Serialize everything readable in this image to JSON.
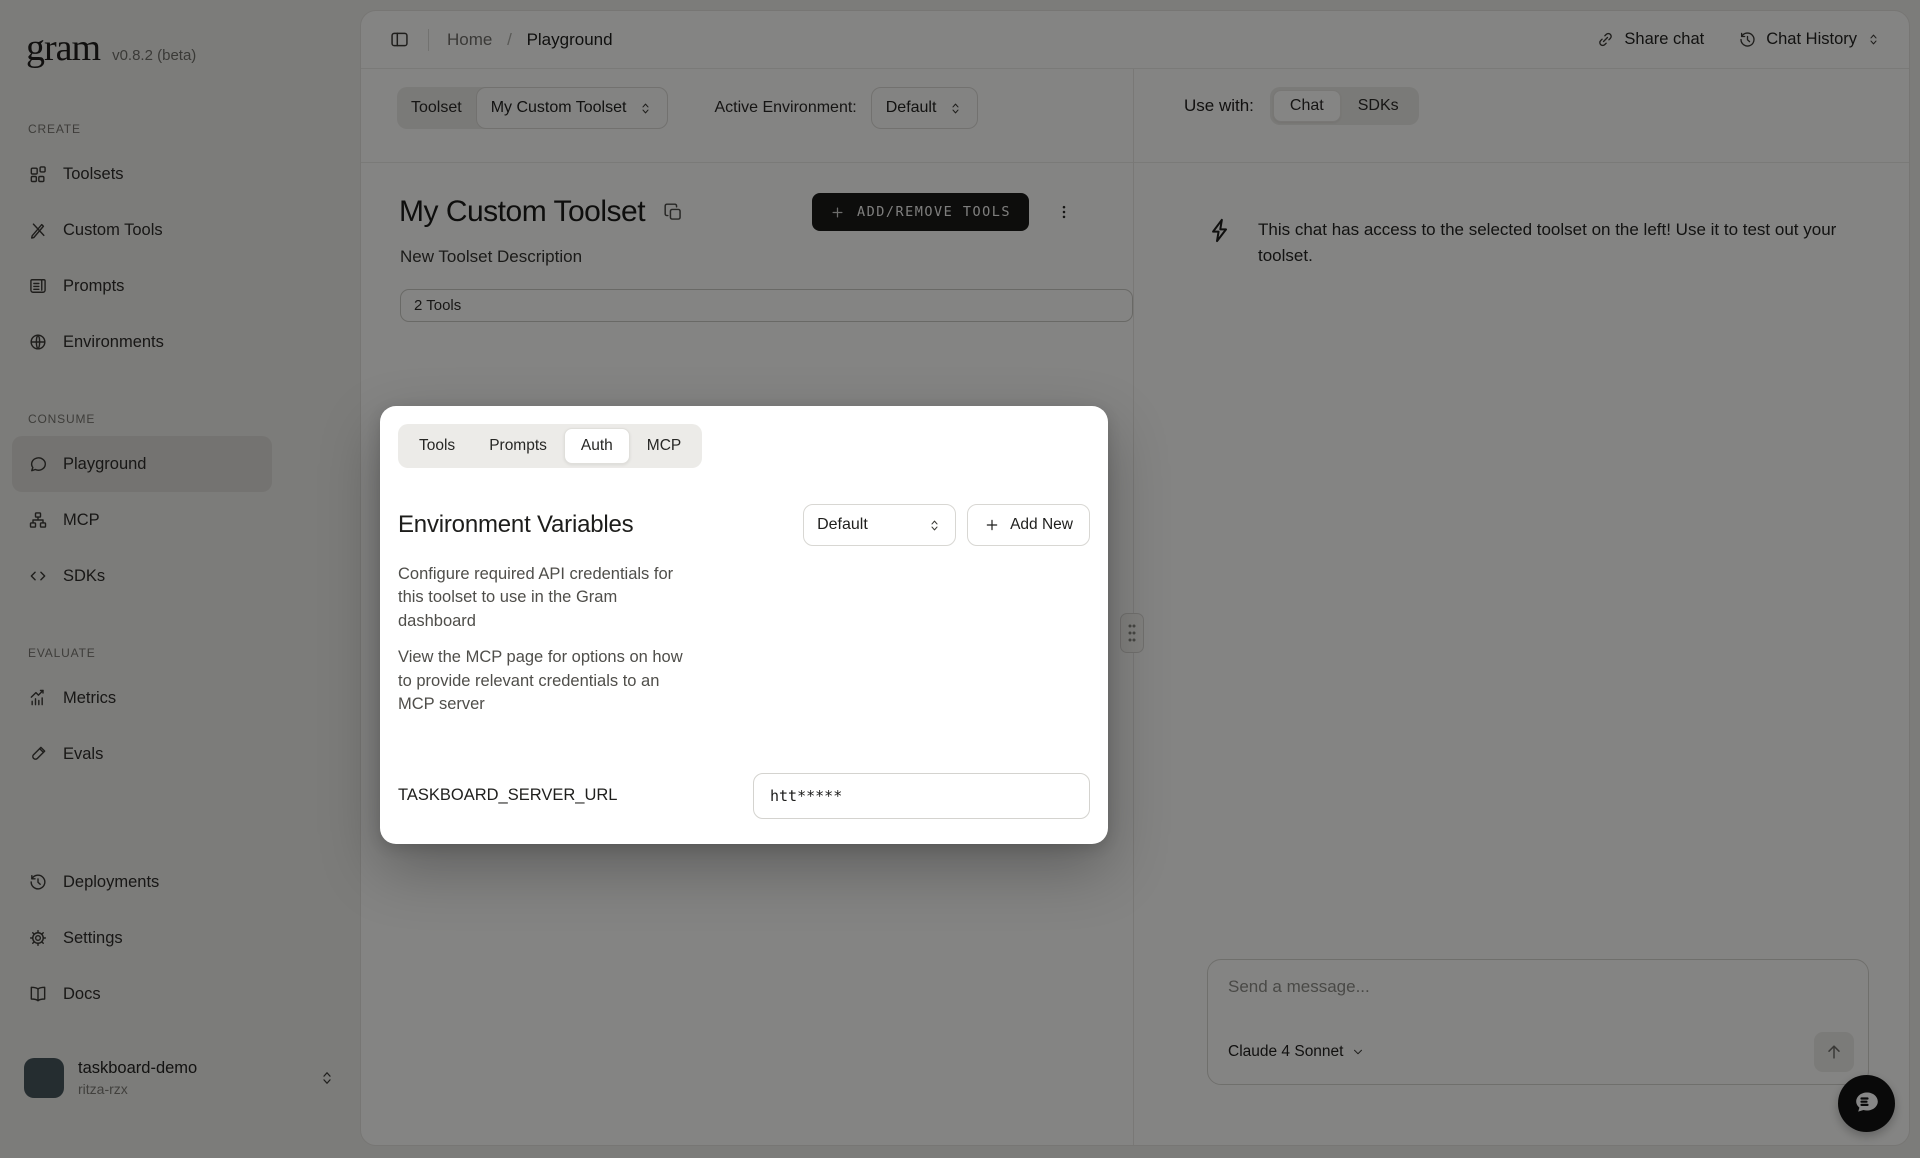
{
  "sidebar": {
    "logo": "gram",
    "version": "v0.8.2 (beta)",
    "sections": [
      {
        "label": "CREATE",
        "items": [
          {
            "label": "Toolsets",
            "icon": "toolsets-icon"
          },
          {
            "label": "Custom Tools",
            "icon": "custom-tools-icon"
          },
          {
            "label": "Prompts",
            "icon": "prompts-icon"
          },
          {
            "label": "Environments",
            "icon": "environments-icon"
          }
        ]
      },
      {
        "label": "CONSUME",
        "items": [
          {
            "label": "Playground",
            "icon": "playground-icon",
            "active": true
          },
          {
            "label": "MCP",
            "icon": "mcp-icon"
          },
          {
            "label": "SDKs",
            "icon": "sdks-icon"
          }
        ]
      },
      {
        "label": "EVALUATE",
        "items": [
          {
            "label": "Metrics",
            "icon": "metrics-icon"
          },
          {
            "label": "Evals",
            "icon": "evals-icon"
          }
        ]
      }
    ],
    "footer_items": [
      {
        "label": "Deployments",
        "icon": "deployments-icon"
      },
      {
        "label": "Settings",
        "icon": "settings-icon"
      },
      {
        "label": "Docs",
        "icon": "docs-icon"
      }
    ],
    "account": {
      "name": "taskboard-demo",
      "org": "ritza-rzx"
    }
  },
  "header": {
    "breadcrumb_home": "Home",
    "breadcrumb_separator": "/",
    "breadcrumb_current": "Playground",
    "share_chat": "Share chat",
    "chat_history": "Chat History"
  },
  "toolbar": {
    "toolset_label": "Toolset",
    "toolset_value": "My Custom Toolset",
    "env_label": "Active Environment:",
    "env_value": "Default",
    "use_with_label": "Use with:",
    "chat_tab": "Chat",
    "sdks_tab": "SDKs"
  },
  "toolset": {
    "title": "My Custom Toolset",
    "add_remove_button": "ADD/REMOVE TOOLS",
    "description": "New Toolset Description",
    "tools_badge": "2 Tools"
  },
  "modal": {
    "tabs": [
      "Tools",
      "Prompts",
      "Auth",
      "MCP"
    ],
    "active_tab": "Auth",
    "heading": "Environment Variables",
    "env_select_value": "Default",
    "add_new_label": "Add New",
    "para1": "Configure required API credentials for this toolset to use in the Gram dashboard",
    "para2": "View the MCP page for options on how to provide relevant credentials to an MCP server",
    "var_label": "TASKBOARD_SERVER_URL",
    "var_value": "htt*****"
  },
  "chat": {
    "notice": "This chat has access to the selected toolset on the left! Use it to test out your toolset.",
    "input_placeholder": "Send a message...",
    "model": "Claude 4 Sonnet"
  },
  "icons": {
    "sidebar_toggle": "panel-left",
    "share": "link",
    "chat_history": "clock-rotate",
    "toolsets": "app-grid",
    "custom_tools": "crossed-pencils",
    "prompts": "news-doc",
    "environments": "globe",
    "playground": "chat-bubble",
    "mcp": "sitemap",
    "sdks": "code-brackets",
    "metrics": "bar-chart-trend",
    "evals": "test-tube",
    "deployments": "clock-rewind",
    "settings": "gear",
    "docs": "open-book",
    "copy": "copy-squares",
    "menu": "kebab-dots",
    "plus": "+",
    "select_chevrons": "up-down-carets",
    "chevron_down": "v",
    "bolt": "lightning",
    "send": "arrow-up",
    "fab": "chat-bubble-filled",
    "grip": "drag-dots"
  }
}
